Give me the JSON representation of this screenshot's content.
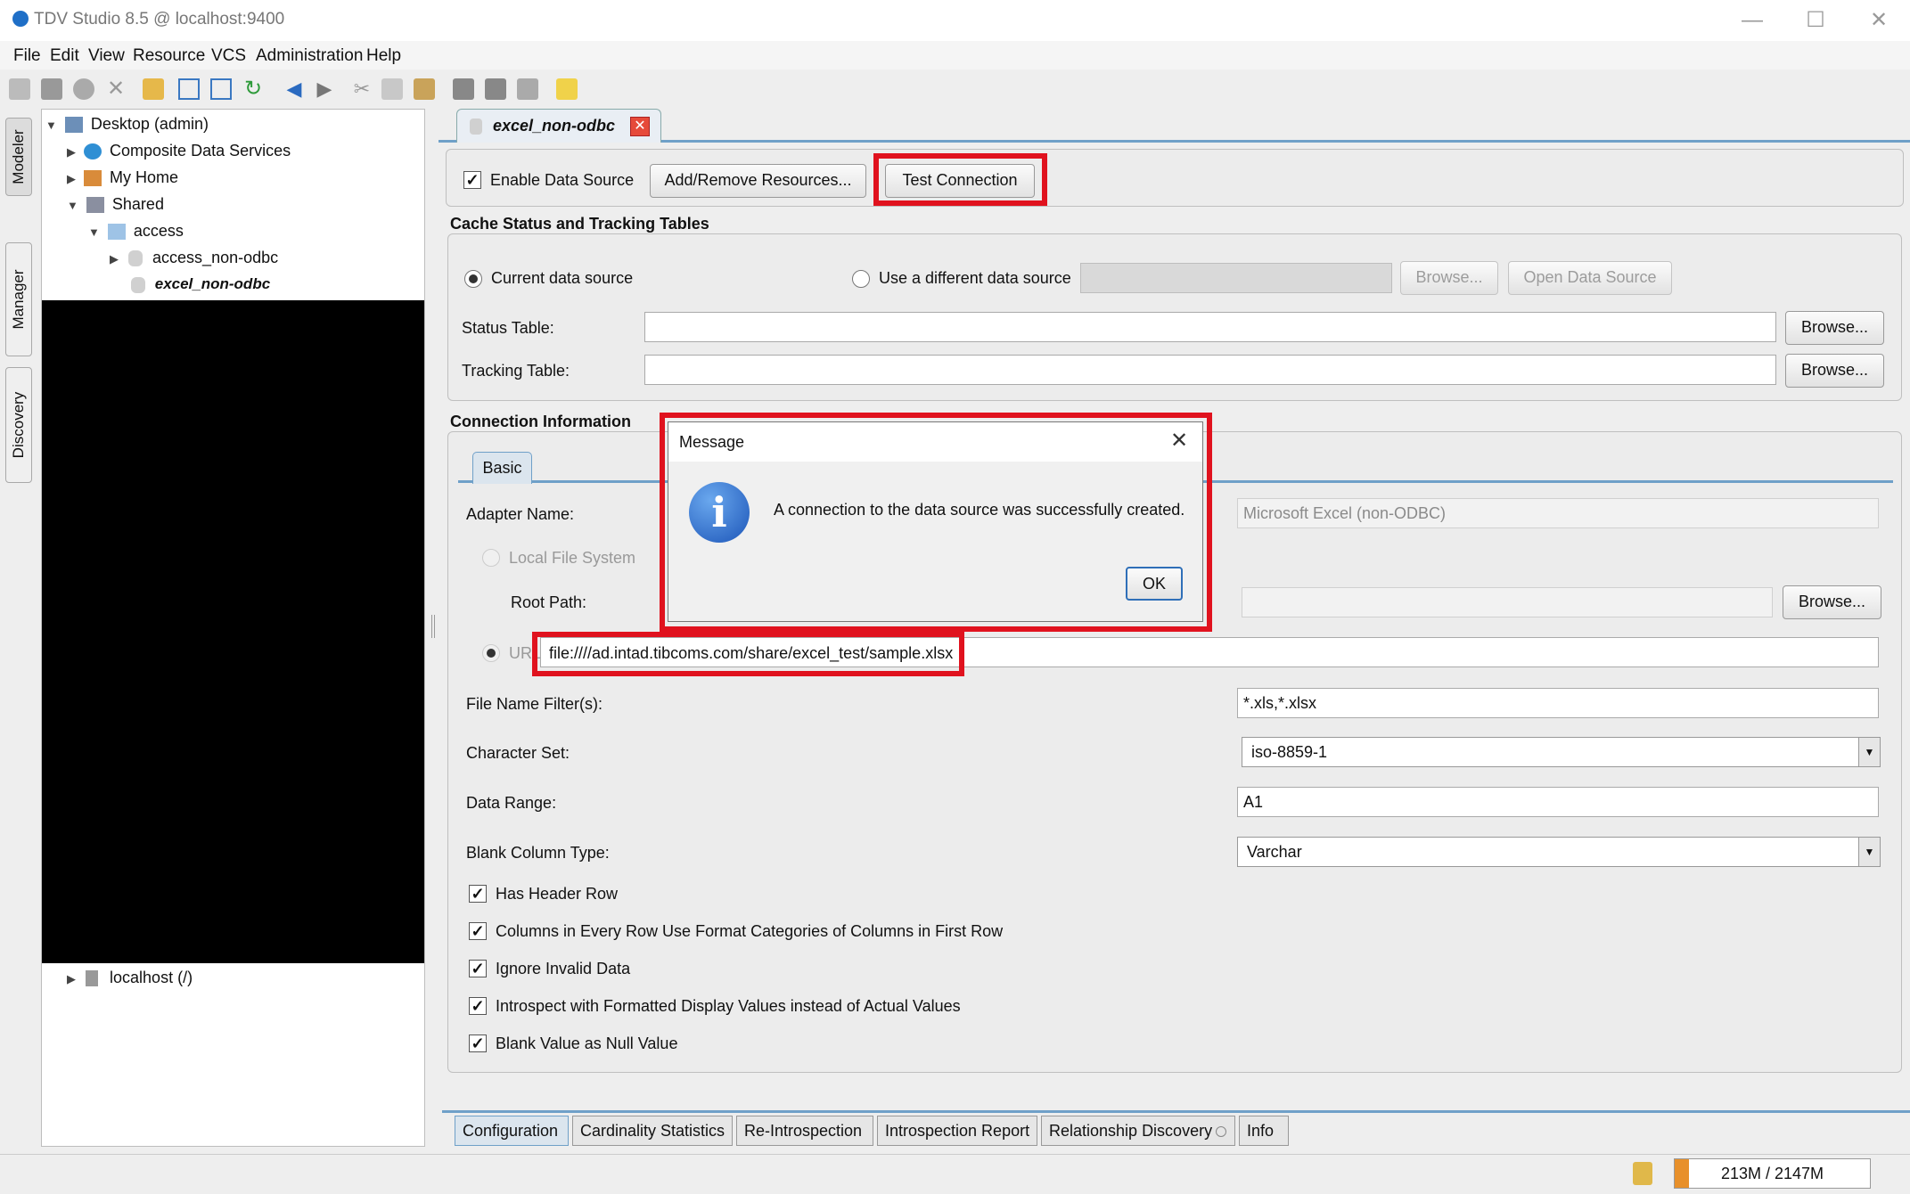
{
  "window": {
    "title": "TDV Studio 8.5 @ localhost:9400"
  },
  "menu": [
    "File",
    "Edit",
    "View",
    "Resource",
    "VCS",
    "Administration",
    "Help"
  ],
  "sidetabs": [
    "Modeler",
    "Manager",
    "Discovery"
  ],
  "tree": {
    "root": "Desktop (admin)",
    "composite": "Composite Data Services",
    "myhome": "My Home",
    "shared": "Shared",
    "access": "access",
    "access_non_odbc": "access_non-odbc",
    "excel_non_odbc": "excel_non-odbc",
    "localhost": "localhost (/)"
  },
  "editor": {
    "tab_label": "excel_non-odbc",
    "enable_label": "Enable Data Source",
    "enable_checked": true,
    "add_remove": "Add/Remove Resources...",
    "test_connection": "Test Connection"
  },
  "cache": {
    "title": "Cache Status and Tracking Tables",
    "current": "Current data source",
    "different": "Use a different data source",
    "browse": "Browse...",
    "open_ds": "Open Data Source",
    "status_table": "Status Table:",
    "tracking_table": "Tracking Table:"
  },
  "conn": {
    "title": "Connection Information",
    "tab_basic": "Basic",
    "adapter_label": "Adapter Name:",
    "adapter_value": "Microsoft Excel (non-ODBC)",
    "local_fs": "Local File System",
    "root_path": "Root Path:",
    "browse": "Browse...",
    "url_label": "URL",
    "url_value": "file:////ad.intad.tibcoms.com/share/excel_test/sample.xlsx",
    "filter_label": "File Name Filter(s):",
    "filter_value": "*.xls,*.xlsx",
    "charset_label": "Character Set:",
    "charset_value": "iso-8859-1",
    "range_label": "Data Range:",
    "range_value": "A1",
    "blank_type_label": "Blank Column Type:",
    "blank_type_value": "Varchar",
    "checks": [
      "Has Header Row",
      "Columns in Every Row Use Format Categories of Columns in First Row",
      "Ignore Invalid Data",
      "Introspect with Formatted Display Values instead of Actual Values",
      "Blank Value as Null Value"
    ]
  },
  "bottom_tabs": [
    "Configuration",
    "Cardinality Statistics",
    "Re-Introspection",
    "Introspection Report",
    "Relationship Discovery",
    "Info"
  ],
  "dialog": {
    "title": "Message",
    "message": "A connection to the data source was successfully created.",
    "ok": "OK"
  },
  "status": {
    "memory": "213M / 2147M"
  },
  "colors": {
    "highlight": "#e0121e",
    "accent": "#6fa0c8"
  }
}
